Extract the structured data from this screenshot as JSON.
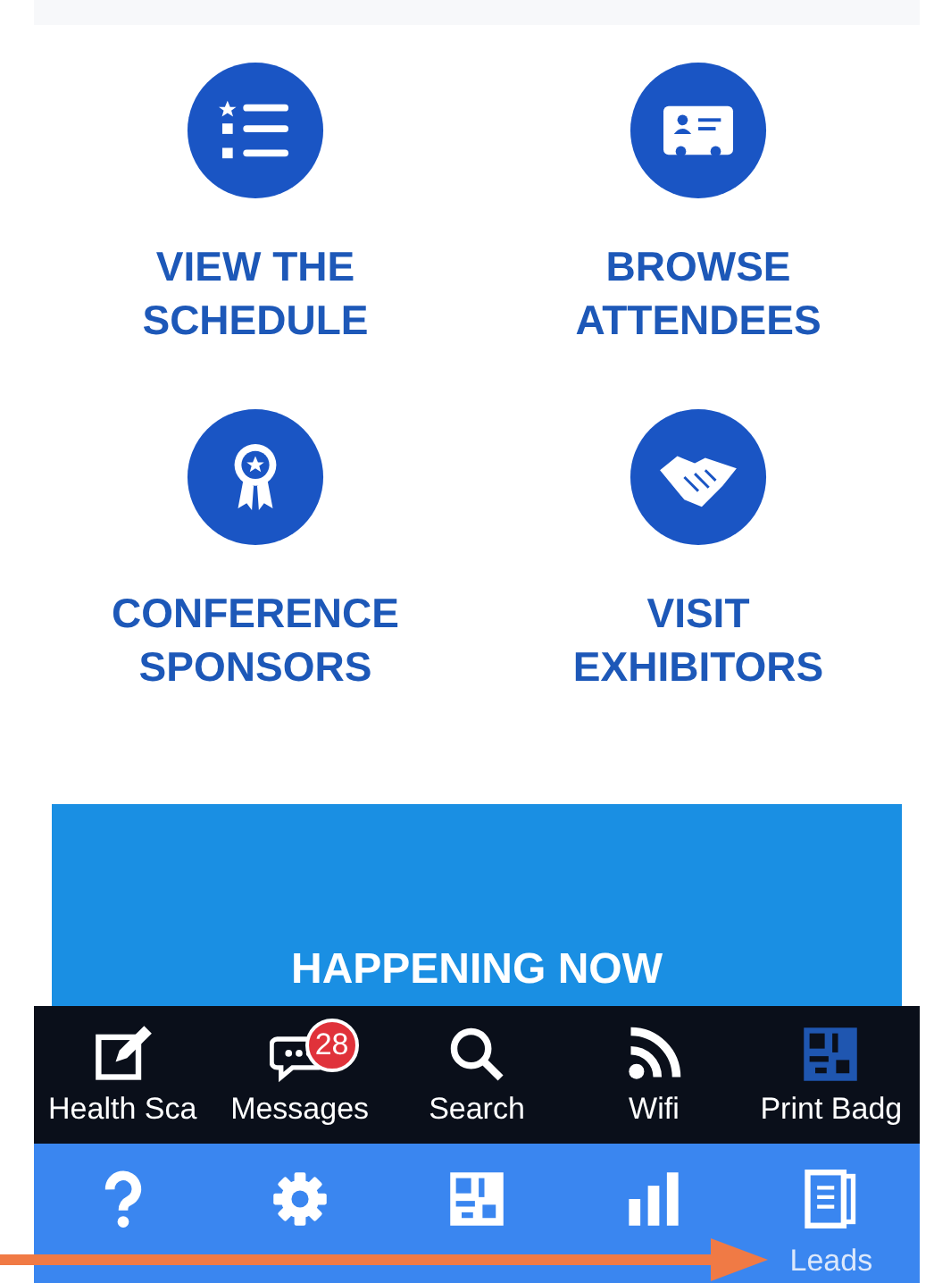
{
  "tiles": [
    {
      "label_lines": [
        "VIEW THE",
        "SCHEDULE"
      ]
    },
    {
      "label_lines": [
        "BROWSE",
        "ATTENDEES"
      ]
    },
    {
      "label_lines": [
        "CONFERENCE",
        "SPONSORS"
      ]
    },
    {
      "label_lines": [
        "VISIT",
        "EXHIBITORS"
      ]
    }
  ],
  "banner": {
    "title": "HAPPENING NOW"
  },
  "toolbar": [
    {
      "label": "Health Sca",
      "disabled": false
    },
    {
      "label": "Messages",
      "badge": "28",
      "disabled": false
    },
    {
      "label": "Search",
      "disabled": false
    },
    {
      "label": "Wifi",
      "disabled": false
    },
    {
      "label": "Print Badg",
      "disabled": true
    }
  ],
  "tab_bar": [
    {
      "kind": "help"
    },
    {
      "kind": "settings"
    },
    {
      "kind": "scanner"
    },
    {
      "kind": "stats"
    },
    {
      "kind": "leads",
      "label": "Leads"
    }
  ]
}
